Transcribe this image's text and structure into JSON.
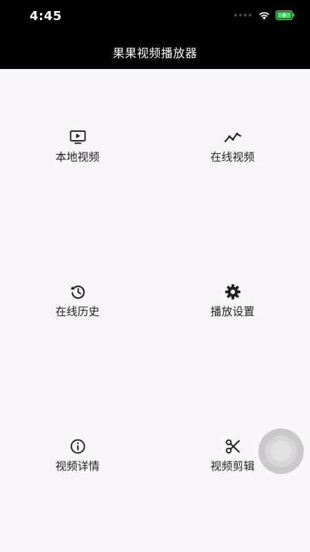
{
  "status_bar": {
    "time": "4:45"
  },
  "app_bar": {
    "title": "果果视频播放器"
  },
  "menu": [
    {
      "label": "本地视频",
      "icon": "tv-play-icon"
    },
    {
      "label": "在线视频",
      "icon": "trending-line-icon"
    },
    {
      "label": "在线历史",
      "icon": "history-icon"
    },
    {
      "label": "播放设置",
      "icon": "gear-icon"
    },
    {
      "label": "视频详情",
      "icon": "info-icon"
    },
    {
      "label": "视频剪辑",
      "icon": "scissors-icon"
    }
  ],
  "colors": {
    "bar": "#000000",
    "background": "#f8f6f9",
    "battery": "#4cd964"
  }
}
